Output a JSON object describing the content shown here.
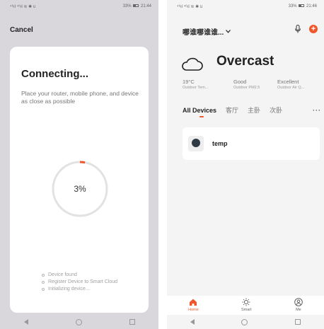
{
  "left": {
    "status": {
      "signal": "⁴⁶ıl ⁴⁶ıl ≋ ✱ ʊ",
      "battery": "33%",
      "time": "21:44"
    },
    "cancel_label": "Cancel",
    "title": "Connecting...",
    "description": "Place your router, mobile phone, and device as close as possible",
    "progress": {
      "text": "3%",
      "value": 0.03
    },
    "steps": [
      "Device found",
      "Register Device to Smart Cloud",
      "Initializing device..."
    ]
  },
  "right": {
    "status": {
      "signal": "⁴⁶ıl ⁴⁶ıl ≋ ✱ ʊ",
      "battery": "33%",
      "time": "21:46"
    },
    "home_name": "哪谁哪谁谁...",
    "weather": {
      "title": "Overcast",
      "icon": "cloud-icon"
    },
    "stats": [
      {
        "value": "19°C",
        "label": "Outdoor Tem..."
      },
      {
        "value": "Good",
        "label": "Outdoor PM2.5"
      },
      {
        "value": "Excellent",
        "label": "Outdoor Air Q..."
      }
    ],
    "tabs": [
      "All Devices",
      "客厅",
      "主卧",
      "次卧"
    ],
    "more_label": "···",
    "device": {
      "name": "temp",
      "icon": "thermostat-icon"
    },
    "tabbar": [
      {
        "label": "Home",
        "icon": "home-icon"
      },
      {
        "label": "Smart",
        "icon": "sun-icon"
      },
      {
        "label": "Me",
        "icon": "user-icon"
      }
    ]
  },
  "colors": {
    "accent": "#f0562b",
    "left_bg": "#d9d6dc",
    "right_bg": "#f4f4f4"
  }
}
